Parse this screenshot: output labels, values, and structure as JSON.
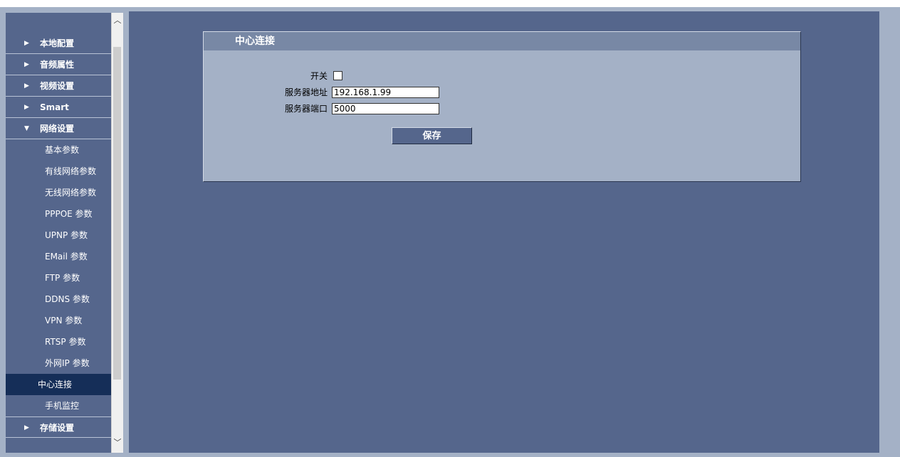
{
  "sidebar": {
    "items": [
      {
        "label": "本地配置",
        "arrow": "▶"
      },
      {
        "label": "音频属性",
        "arrow": "▶"
      },
      {
        "label": "视频设置",
        "arrow": "▶"
      },
      {
        "label": "Smart",
        "arrow": "▶"
      },
      {
        "label": "网络设置",
        "arrow": "▼"
      }
    ],
    "sub_items": [
      {
        "label": "基本参数"
      },
      {
        "label": "有线网络参数"
      },
      {
        "label": "无线网络参数"
      },
      {
        "label": "PPPOE 参数"
      },
      {
        "label": "UPNP 参数"
      },
      {
        "label": "EMail 参数"
      },
      {
        "label": "FTP 参数"
      },
      {
        "label": "DDNS 参数"
      },
      {
        "label": "VPN 参数"
      },
      {
        "label": "RTSP 参数"
      },
      {
        "label": "外网IP 参数"
      },
      {
        "label": "中心连接",
        "active": true
      },
      {
        "label": "手机监控"
      }
    ],
    "after_items": [
      {
        "label": "存储设置",
        "arrow": "▶"
      }
    ],
    "scroll_up": "︿",
    "scroll_down": "﹀"
  },
  "panel": {
    "title": "中心连接",
    "switch_label": "开关",
    "switch_checked": false,
    "server_address_label": "服务器地址",
    "server_address_value": "192.168.1.99",
    "server_port_label": "服务器端口",
    "server_port_value": "5000",
    "save_label": "保存"
  },
  "colors": {
    "content_bg": "#55668c",
    "panel_bg": "#a4b1c6",
    "panel_title_bg": "#7888a5",
    "active_item_bg": "#152e58"
  }
}
